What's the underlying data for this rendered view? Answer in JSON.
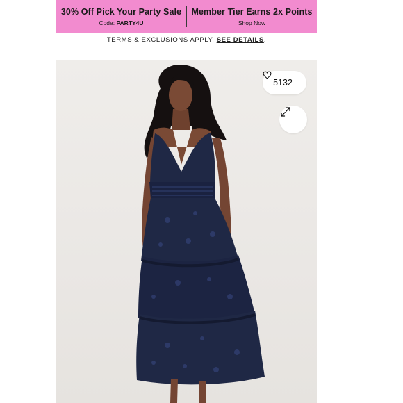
{
  "promo": {
    "left": {
      "title": "30% Off Pick Your Party Sale",
      "code_label": "Code:",
      "code": "PARTY4U"
    },
    "right": {
      "title": "Member Tier Earns 2x Points",
      "link": "Shop Now"
    }
  },
  "terms": {
    "text": "TERMS & EXCLUSIONS APPLY.",
    "link": "SEE DETAILS",
    "punct": "."
  },
  "product": {
    "like_count": "5132",
    "icons": {
      "like": "heart-icon",
      "zoom": "expand-icon"
    },
    "colors": {
      "dress": "#1f2845",
      "dress_shadow": "#141a30",
      "skin": "#7a4a35",
      "hair": "#151010",
      "background": "#ece9e6"
    }
  }
}
